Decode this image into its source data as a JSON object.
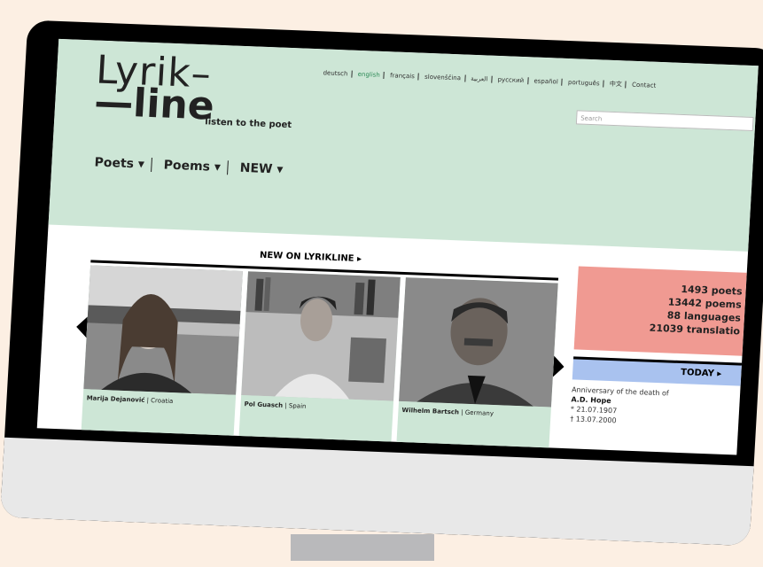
{
  "site": {
    "logo_line1": "Lyrik–",
    "logo_line2": "—line",
    "tagline": "listen to the poet"
  },
  "languages": [
    "deutsch",
    "english",
    "français",
    "slovenščina",
    "العربية",
    "русский",
    "español",
    "português",
    "中文",
    "Contact"
  ],
  "selected_language": "english",
  "search": {
    "placeholder": "Search"
  },
  "nav": {
    "poets": "Poets ▾",
    "poems": "Poems ▾",
    "new": "NEW ▾"
  },
  "new_section": {
    "title": "NEW ON LYRIKLINE ▸"
  },
  "cards": [
    {
      "name": "Marija Dejanović",
      "country": "Croatia"
    },
    {
      "name": "Pol Guasch",
      "country": "Spain"
    },
    {
      "name": "Wilhelm Bartsch",
      "country": "Germany"
    }
  ],
  "stats": {
    "poets": "1493 poets",
    "poems": "13442 poems",
    "languages": "88 languages",
    "translations": "21039 translatio"
  },
  "today": {
    "title": "TODAY ▸",
    "label": "Anniversary of the death of",
    "name": "A.D. Hope",
    "born": "* 21.07.1907",
    "died": "† 13.07.2000"
  },
  "colors": {
    "header_bg": "#cde6d6",
    "stats_bg": "#f09a92",
    "today_bg": "#a9c2ef",
    "page_bg": "#fcefe3"
  }
}
